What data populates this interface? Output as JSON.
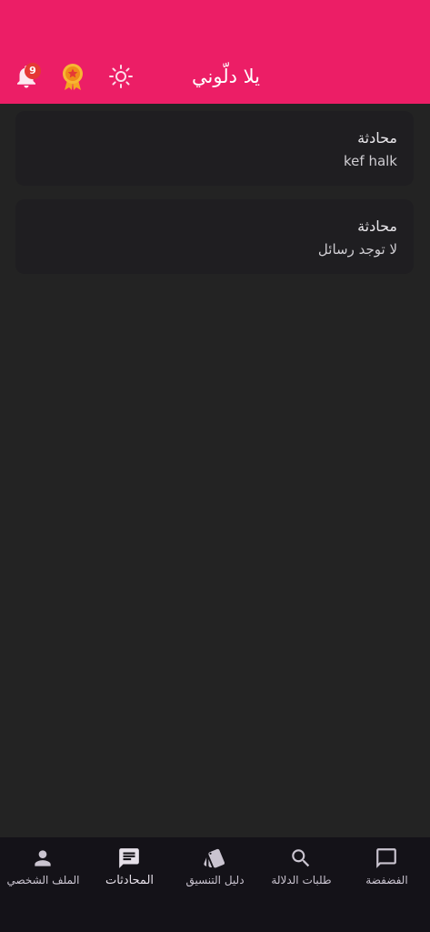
{
  "header": {
    "title": "يلا دلّوني",
    "notification_count": "9",
    "icons": {
      "bell": "bell-icon",
      "medal": "medal-icon",
      "theme": "sun-icon"
    },
    "colors": {
      "background": "#ec1e66",
      "badge": "#e53935",
      "medal": "#f5a623"
    }
  },
  "conversations": [
    {
      "name": "محادثة",
      "last_message": "kef halk"
    },
    {
      "name": "محادثة",
      "last_message": "لا توجد رسائل"
    }
  ],
  "bottom_nav": {
    "active": "chats",
    "items": [
      {
        "id": "profile",
        "label": "الملف الشخصي",
        "icon": "person-icon"
      },
      {
        "id": "chats",
        "label": "المحادثات",
        "icon": "chat-icon"
      },
      {
        "id": "guide",
        "label": "دليل التنسيق",
        "icon": "swatch-icon"
      },
      {
        "id": "requests",
        "label": "طلبات الدلالة",
        "icon": "search-icon"
      },
      {
        "id": "venting",
        "label": "الفضفضة",
        "icon": "message-outline-icon"
      }
    ]
  },
  "colors": {
    "page_background": "#232323",
    "card_background": "#1f1e21",
    "nav_background": "#141218"
  }
}
